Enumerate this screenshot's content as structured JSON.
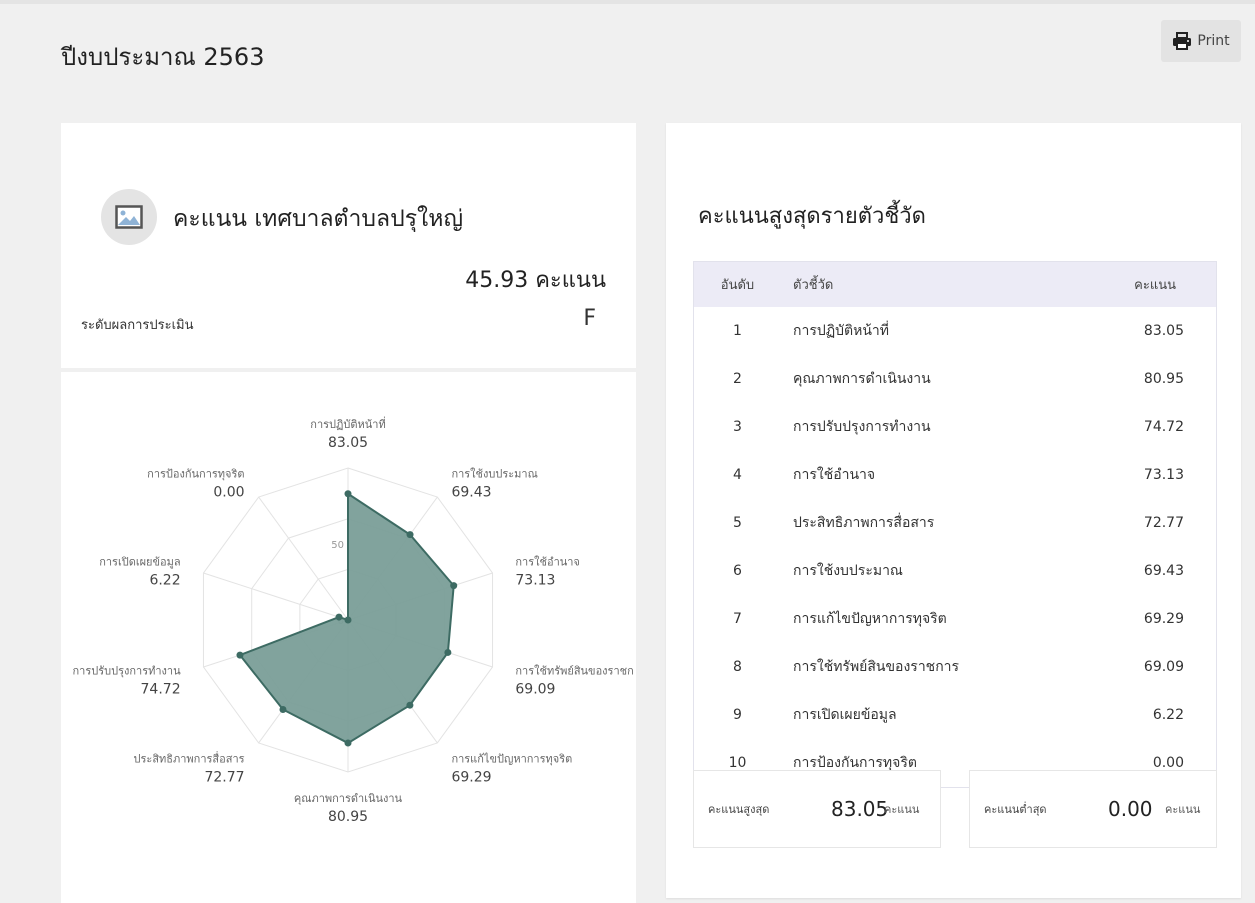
{
  "page": {
    "title": "ปีงบประมาณ 2563",
    "print_label": "Print",
    "print_icon": "printer-icon"
  },
  "summary": {
    "image_icon": "image-placeholder-icon",
    "org_title": "คะแนน เทศบาลตำบลปรุใหญ่",
    "score": "45.93",
    "score_unit": "คะแนน",
    "level_label": "ระดับผลการประเมิน",
    "level_value": "F"
  },
  "chart_data": {
    "type": "radar",
    "r_ticks": [
      "0",
      "50"
    ],
    "r_max": 100,
    "categories": [
      "การปฏิบัติหน้าที่",
      "การใช้งบประมาณ",
      "การใช้อำนาจ",
      "การใช้ทรัพย์สินของราชก",
      "การแก้ไขปัญหาการทุจริต",
      "คุณภาพการดำเนินงาน",
      "ประสิทธิภาพการสื่อสาร",
      "การปรับปรุงการทำงาน",
      "การเปิดเผยข้อมูล",
      "การป้องกันการทุจริต"
    ],
    "values": [
      83.05,
      69.43,
      73.13,
      69.09,
      69.29,
      80.95,
      72.77,
      74.72,
      6.22,
      0.0
    ],
    "value_labels": [
      "83.05",
      "69.43",
      "73.13",
      "69.09",
      "69.29",
      "80.95",
      "72.77",
      "74.72",
      "6.22",
      "0.00"
    ],
    "fill_color": "#7a9e98",
    "line_color": "#3d6b63",
    "grid": true
  },
  "ranking": {
    "title": "คะแนนสูงสุดรายตัวชี้วัด",
    "headers": {
      "rank": "อันดับ",
      "name": "ตัวชี้วัด",
      "score": "คะแนน"
    },
    "rows": [
      {
        "rank": "1",
        "name": "การปฏิบัติหน้าที่",
        "score": "83.05"
      },
      {
        "rank": "2",
        "name": "คุณภาพการดำเนินงาน",
        "score": "80.95"
      },
      {
        "rank": "3",
        "name": "การปรับปรุงการทำงาน",
        "score": "74.72"
      },
      {
        "rank": "4",
        "name": "การใช้อำนาจ",
        "score": "73.13"
      },
      {
        "rank": "5",
        "name": "ประสิทธิภาพการสื่อสาร",
        "score": "72.77"
      },
      {
        "rank": "6",
        "name": "การใช้งบประมาณ",
        "score": "69.43"
      },
      {
        "rank": "7",
        "name": "การแก้ไขปัญหาการทุจริต",
        "score": "69.29"
      },
      {
        "rank": "8",
        "name": "การใช้ทรัพย์สินของราชการ",
        "score": "69.09"
      },
      {
        "rank": "9",
        "name": "การเปิดเผยข้อมูล",
        "score": "6.22"
      },
      {
        "rank": "10",
        "name": "การป้องกันการทุจริต",
        "score": "0.00"
      }
    ],
    "max": {
      "label": "คะแนนสูงสุด",
      "value": "83.05",
      "unit": "คะแนน"
    },
    "min": {
      "label": "คะแนนต่ำสุด",
      "value": "0.00",
      "unit": "คะแนน"
    }
  }
}
